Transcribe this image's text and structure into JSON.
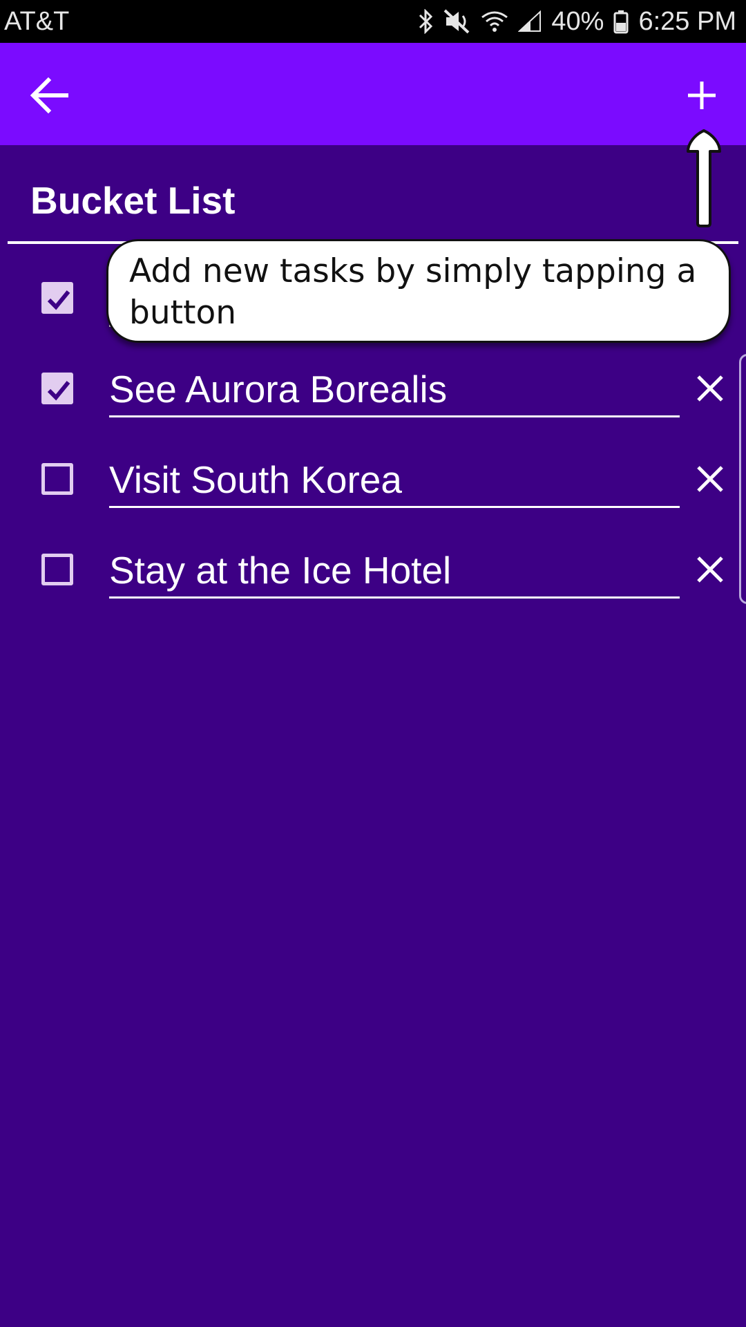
{
  "status_bar": {
    "carrier": "AT&T",
    "battery": "40%",
    "time": "6:25 PM"
  },
  "toolbar": {
    "back_icon": "arrow-left-icon",
    "add_icon": "plus-icon"
  },
  "list": {
    "title": "Bucket List"
  },
  "tasks": [
    {
      "text": "",
      "checked": true
    },
    {
      "text": "See Aurora Borealis",
      "checked": true
    },
    {
      "text": "Visit South Korea",
      "checked": false
    },
    {
      "text": "Stay at the Ice Hotel",
      "checked": false
    }
  ],
  "tooltip": {
    "text": "Add new tasks by simply tapping a button"
  },
  "colors": {
    "background": "#3d0085",
    "toolbar": "#7b0bff",
    "checkbox": "#e2cdf0"
  }
}
